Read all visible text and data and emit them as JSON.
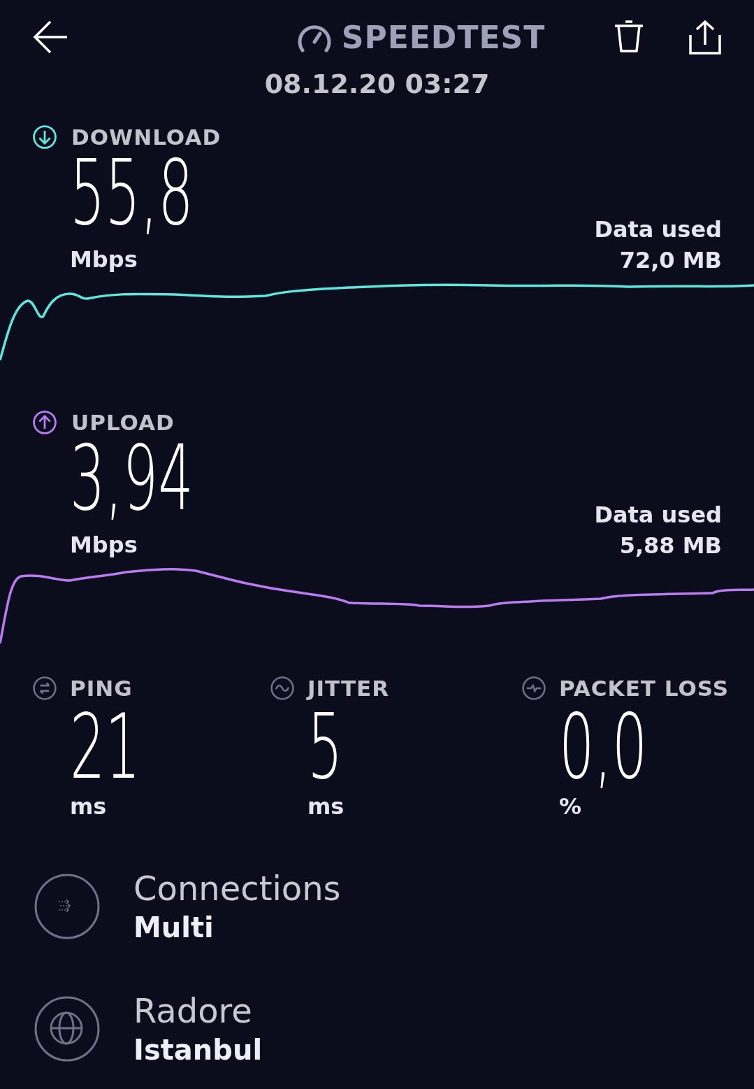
{
  "header": {
    "title": "SPEEDTEST",
    "date": "08.12.20 03:27"
  },
  "speeds": [
    {
      "kind": "download",
      "label": "DOWNLOAD",
      "value": "55,8",
      "unit": "Mbps",
      "data_label": "Data used",
      "data_value": "72,0 MB",
      "color": "#5ee6dc"
    },
    {
      "kind": "upload",
      "label": "UPLOAD",
      "value": "3,94",
      "unit": "Mbps",
      "data_label": "Data used",
      "data_value": "5,88 MB",
      "color": "#b87cf0"
    }
  ],
  "metrics": [
    {
      "kind": "ping",
      "label": "PING",
      "value": "21",
      "unit": "ms"
    },
    {
      "kind": "jitter",
      "label": "JITTER",
      "value": "5",
      "unit": "ms"
    },
    {
      "kind": "packet_loss",
      "label": "PACKET LOSS",
      "value": "0,0",
      "unit": "%"
    }
  ],
  "info": [
    {
      "kind": "connections",
      "title": "Connections",
      "value": "Multi"
    },
    {
      "kind": "server",
      "title": "Radore",
      "value": "Istanbul"
    }
  ]
}
